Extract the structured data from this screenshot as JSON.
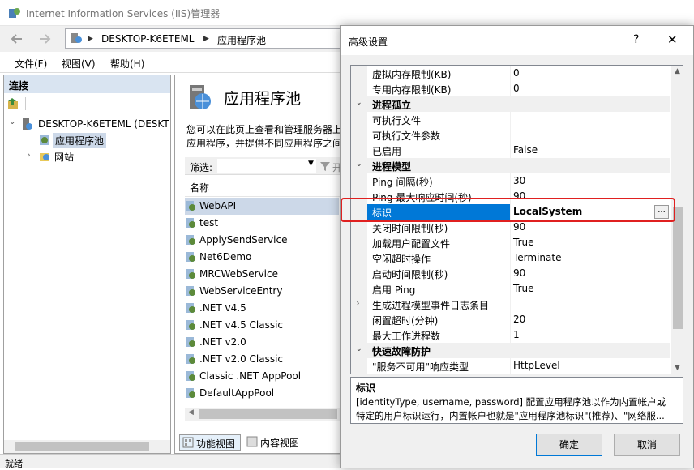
{
  "window": {
    "title": "Internet Information Services (IIS)管理器",
    "address": {
      "computer": "DESKTOP-K6ETEML",
      "separator": "▶",
      "page": "应用程序池"
    },
    "menu": [
      "文件(F)",
      "视图(V)",
      "帮助(H)"
    ],
    "status": "就绪"
  },
  "connections": {
    "header": "连接",
    "tree": {
      "server": "DESKTOP-K6ETEML (DESKT",
      "app_pools": "应用程序池",
      "sites": "网站"
    }
  },
  "content": {
    "title": "应用程序池",
    "description_line1": "您可以在此页上查看和管理服务器上",
    "description_line2": "应用程序，并提供不同应用程序之间",
    "filter_label": "筛选:",
    "filter_extra": "开",
    "column_name": "名称",
    "pools": [
      "WebAPI",
      "test",
      "ApplySendService",
      "Net6Demo",
      "MRCWebService",
      "WebServiceEntry",
      ".NET v4.5",
      ".NET v4.5 Classic",
      ".NET v2.0",
      ".NET v2.0 Classic",
      "Classic .NET AppPool",
      "DefaultAppPool"
    ],
    "selected_pool": "WebAPI",
    "view_tabs": {
      "features": "功能视图",
      "content": "内容视图"
    }
  },
  "dialog": {
    "title": "高级设置",
    "help": "?",
    "close": "✕",
    "properties": [
      {
        "name": "虚拟内存限制(KB)",
        "value": "0"
      },
      {
        "name": "专用内存限制(KB)",
        "value": "0"
      },
      {
        "category": "进程孤立",
        "expanded": true
      },
      {
        "name": "可执行文件",
        "value": ""
      },
      {
        "name": "可执行文件参数",
        "value": ""
      },
      {
        "name": "已启用",
        "value": "False"
      },
      {
        "category": "进程模型",
        "expanded": true
      },
      {
        "name": "Ping 间隔(秒)",
        "value": "30"
      },
      {
        "name": "Ping 最大响应时间(秒)",
        "value": "90"
      },
      {
        "name": "标识",
        "value": "LocalSystem",
        "selected": true
      },
      {
        "name": "关闭时间限制(秒)",
        "value": "90"
      },
      {
        "name": "加载用户配置文件",
        "value": "True"
      },
      {
        "name": "空闲超时操作",
        "value": "Terminate"
      },
      {
        "name": "启动时间限制(秒)",
        "value": "90"
      },
      {
        "name": "启用 Ping",
        "value": "True"
      },
      {
        "name": "生成进程模型事件日志条目",
        "value": "",
        "collapsed": true
      },
      {
        "name": "闲置超时(分钟)",
        "value": "20"
      },
      {
        "name": "最大工作进程数",
        "value": "1"
      },
      {
        "category": "快速故障防护",
        "expanded": true
      },
      {
        "name": "\"服务不可用\"响应类型",
        "value": "HttpLevel"
      }
    ],
    "ellipsis": "...",
    "description_title": "标识",
    "description_line1": "[identityType, username, password] 配置应用程序池以作为内置帐户或",
    "description_line2": "特定的用户标识运行，内置帐户也就是\"应用程序池标识\"(推荐)、\"网络服...",
    "ok": "确定",
    "cancel": "取消"
  },
  "colors": {
    "selection": "#0078d7",
    "highlight_box": "#e02020"
  }
}
